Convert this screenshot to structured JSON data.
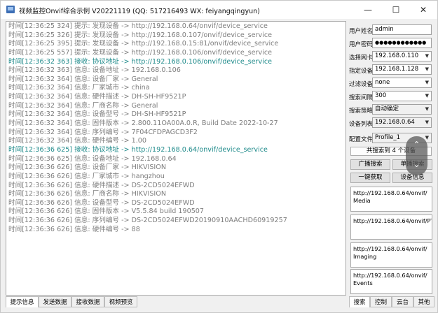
{
  "window": {
    "title": "视频监控Onvif综合示例 V20221119 (QQ: 517216493 WX: feiyangqingyun)",
    "controls": [
      "—",
      "☐",
      "✕"
    ]
  },
  "log": [
    {
      "text": "时间[12:36:25 324] 提示: 发现设备 -> http://192.168.0.64/onvif/device_service",
      "type": "info"
    },
    {
      "text": "时间[12:36:25 326] 提示: 发现设备 -> http://192.168.0.107/onvif/device_service",
      "type": "info"
    },
    {
      "text": "时间[12:36:25 395] 提示: 发现设备 -> http://192.168.0.15:81/onvif/device_service",
      "type": "info"
    },
    {
      "text": "时间[12:36:25 557] 提示: 发现设备 -> http://192.168.0.106/onvif/device_service",
      "type": "info"
    },
    {
      "text": "时间[12:36:32 363] 接收: 协议地址 -> http://192.168.0.106/onvif/device_service",
      "type": "recv"
    },
    {
      "text": "时间[12:36:32 363] 信息: 设备地址 -> 192.168.0.106",
      "type": "info"
    },
    {
      "text": "时间[12:36:32 364] 信息: 设备厂家 -> General",
      "type": "info"
    },
    {
      "text": "时间[12:36:32 364] 信息: 厂家城市 -> china",
      "type": "info"
    },
    {
      "text": "时间[12:36:32 364] 信息: 硬件描述 -> DH-SH-HF9521P",
      "type": "info"
    },
    {
      "text": "时间[12:36:32 364] 信息: 厂商名称 -> General",
      "type": "info"
    },
    {
      "text": "时间[12:36:32 364] 信息: 设备型号 -> DH-SH-HF9521P",
      "type": "info"
    },
    {
      "text": "时间[12:36:32 364] 信息: 固件版本 -> 2.800.11OA00A.0.R, Build Date 2022-10-27",
      "type": "info"
    },
    {
      "text": "时间[12:36:32 364] 信息: 序列编号 -> 7F04CFDPAGCD3F2",
      "type": "info"
    },
    {
      "text": "时间[12:36:32 364] 信息: 硬件编号 -> 1.00",
      "type": "info"
    },
    {
      "text": "时间[12:36:36 625] 接收: 协议地址 -> http://192.168.0.64/onvif/device_service",
      "type": "recv"
    },
    {
      "text": "时间[12:36:36 625] 信息: 设备地址 -> 192.168.0.64",
      "type": "info"
    },
    {
      "text": "时间[12:36:36 626] 信息: 设备厂家 -> HIKVISION",
      "type": "info"
    },
    {
      "text": "时间[12:36:36 626] 信息: 厂家城市 -> hangzhou",
      "type": "info"
    },
    {
      "text": "时间[12:36:36 626] 信息: 硬件描述 -> DS-2CD5024EFWD",
      "type": "info"
    },
    {
      "text": "时间[12:36:36 626] 信息: 厂商名称 -> HIKVISION",
      "type": "info"
    },
    {
      "text": "时间[12:36:36 626] 信息: 设备型号 -> DS-2CD5024EFWD",
      "type": "info"
    },
    {
      "text": "时间[12:36:36 626] 信息: 固件版本 -> V5.5.84 build 190507",
      "type": "info"
    },
    {
      "text": "时间[12:36:36 626] 信息: 序列编号 -> DS-2CD5024EFWD20190910AACHD60919257",
      "type": "info"
    },
    {
      "text": "时间[12:36:36 626] 信息: 硬件编号 -> 88",
      "type": "info"
    }
  ],
  "bottom_tabs": [
    "提示信息",
    "发送数据",
    "接收数据",
    "视频预览"
  ],
  "panel": {
    "username_label": "用户姓名",
    "username": "admin",
    "password_label": "用户密码",
    "password": "●●●●●●●●●●●●",
    "nic_label": "选择网卡",
    "nic": "192.168.0.110",
    "device_label": "指定设备",
    "device": "192.168.1.128",
    "filter_label": "过滤设备",
    "filter": "none",
    "interval_label": "搜索间隔",
    "interval": "300",
    "strategy_label": "搜索策略",
    "strategy": "自动确定",
    "devlist_label": "设备列表",
    "devlist": "192.168.0.64",
    "profile_label": "配置文件",
    "profile": "Profile_1",
    "count_text": "共搜索到 4 个设备",
    "broadcast_btn": "广播搜索",
    "single_btn": "单播搜索",
    "fetch_btn": "一键获取",
    "devinfo_btn": "设备信息",
    "urls": [
      [
        "http://192.168.0.64/onvif/",
        "Media"
      ],
      [
        "http://192.168.0.64/onvif/PTZ"
      ],
      [
        "http://192.168.0.64/onvif/",
        "Imaging"
      ],
      [
        "http://192.168.0.64/onvif/",
        "Events"
      ]
    ]
  },
  "right_tabs": [
    "搜索",
    "控制",
    "云台",
    "其他"
  ],
  "scroll_overlay": {
    "up": "⌃",
    "down": "⌄"
  }
}
